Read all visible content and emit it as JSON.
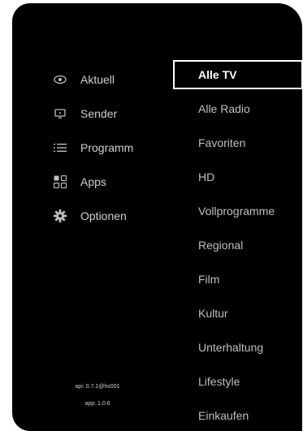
{
  "nav": {
    "items": [
      {
        "label": "Aktuell",
        "icon": "eye-icon"
      },
      {
        "label": "Sender",
        "icon": "tv-icon"
      },
      {
        "label": "Programm",
        "icon": "list-icon"
      },
      {
        "label": "Apps",
        "icon": "apps-grid-icon"
      },
      {
        "label": "Optionen",
        "icon": "gear-icon"
      }
    ]
  },
  "submenu": {
    "selected": "Alle TV",
    "items": [
      {
        "label": "Alle TV"
      },
      {
        "label": "Alle Radio"
      },
      {
        "label": "Favoriten"
      },
      {
        "label": "HD"
      },
      {
        "label": "Vollprogramme"
      },
      {
        "label": "Regional"
      },
      {
        "label": "Film"
      },
      {
        "label": "Kultur"
      },
      {
        "label": "Unterhaltung"
      },
      {
        "label": "Lifestyle"
      },
      {
        "label": "Einkaufen"
      }
    ]
  },
  "footer": {
    "api_version": "api: 0.7.1@hs001",
    "app_version": "app: 1.0.6"
  },
  "colors": {
    "background": "#000000",
    "text": "#bfbfbf",
    "selected_text": "#ffffff",
    "selected_border": "#ffffff"
  }
}
